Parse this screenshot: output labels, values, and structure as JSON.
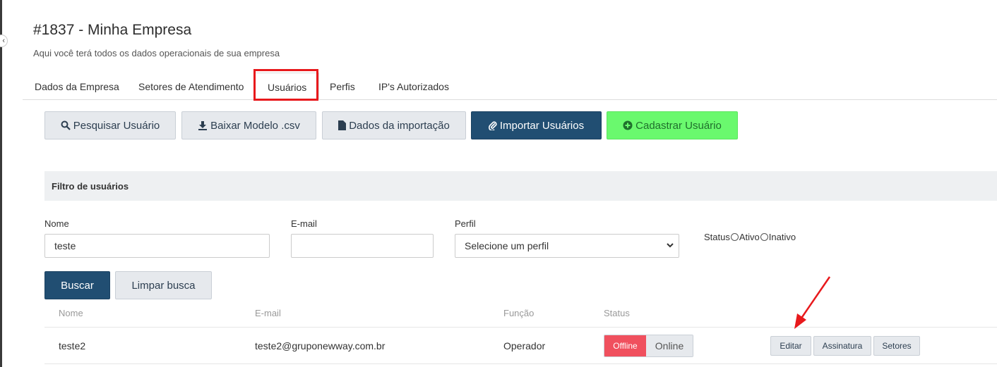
{
  "header": {
    "title": "#1837 - Minha Empresa",
    "subtitle": "Aqui você terá todos os dados operacionais de sua empresa"
  },
  "tabs": [
    {
      "label": "Dados da Empresa",
      "active": false
    },
    {
      "label": "Setores de Atendimento",
      "active": false
    },
    {
      "label": "Usuários",
      "active": true
    },
    {
      "label": "Perfis",
      "active": false
    },
    {
      "label": "IP's Autorizados",
      "active": false
    }
  ],
  "toolbar": {
    "search_label": "Pesquisar Usuário",
    "download_label": "Baixar Modelo .csv",
    "import_data_label": "Dados da importação",
    "import_label": "Importar Usuários",
    "register_label": "Cadastrar Usuário"
  },
  "filter": {
    "title": "Filtro de usuários",
    "name_label": "Nome",
    "name_value": "teste",
    "email_label": "E-mail",
    "email_value": "",
    "profile_label": "Perfil",
    "profile_value": "Selecione um perfil",
    "status_label": "Status",
    "status_options": [
      "Ativo",
      "Inativo"
    ],
    "search_button": "Buscar",
    "clear_button": "Limpar busca"
  },
  "table": {
    "headers": [
      "Nome",
      "E-mail",
      "Função",
      "Status"
    ],
    "rows": [
      {
        "name": "teste2",
        "email": "teste2@gruponewway.com.br",
        "role": "Operador",
        "status_offline": "Offline",
        "status_online": "Online",
        "actions": [
          "Editar",
          "Assinatura",
          "Setores"
        ]
      }
    ]
  },
  "colors": {
    "primary_dark": "#214e72",
    "success": "#6af96e",
    "danger": "#f0505e",
    "annotation": "#e8191c"
  }
}
